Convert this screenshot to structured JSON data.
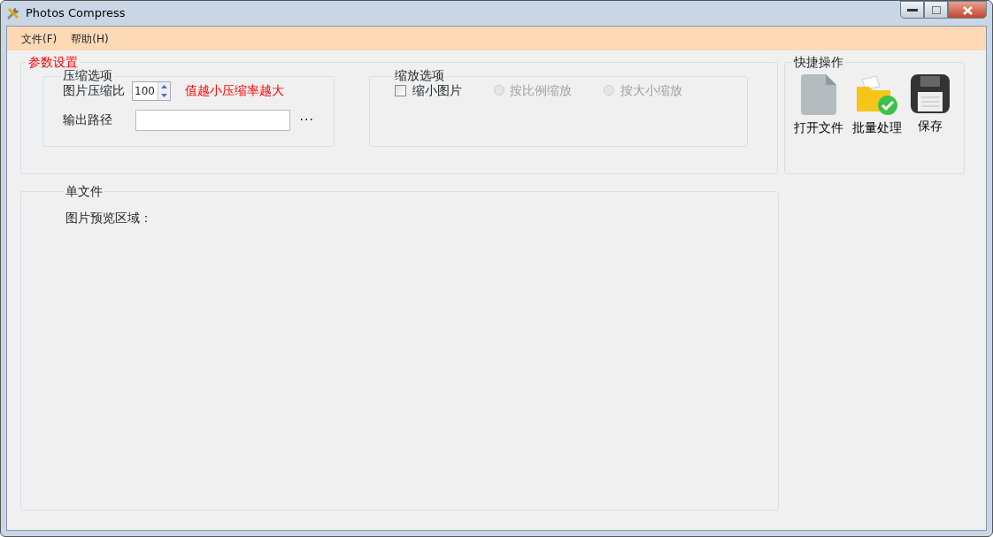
{
  "window": {
    "title": "Photos Compress"
  },
  "menu": [
    "文件(F)",
    "帮助(H)"
  ],
  "params": {
    "title": "参数设置",
    "compress": {
      "title": "压缩选项",
      "ratio_label": "图片压缩比",
      "ratio_value": "100",
      "hint": "值越小压缩率越大",
      "output_label": "输出路径",
      "browse": "···"
    },
    "scale": {
      "title": "缩放选项",
      "shrink": {
        "label": "缩小图片",
        "checked": false
      },
      "modes": [
        {
          "label": "按比例缩放",
          "selected": false,
          "disabled": true
        },
        {
          "label": "按大小缩放",
          "selected": false,
          "disabled": true
        }
      ]
    }
  },
  "quick": {
    "title": "快捷操作",
    "actions": [
      {
        "kind": "file",
        "label": "打开文件"
      },
      {
        "kind": "batch",
        "label": "批量处理"
      },
      {
        "kind": "save",
        "label": "保存"
      }
    ]
  },
  "single": {
    "title": "单文件",
    "preview_label": "图片预览区域："
  }
}
